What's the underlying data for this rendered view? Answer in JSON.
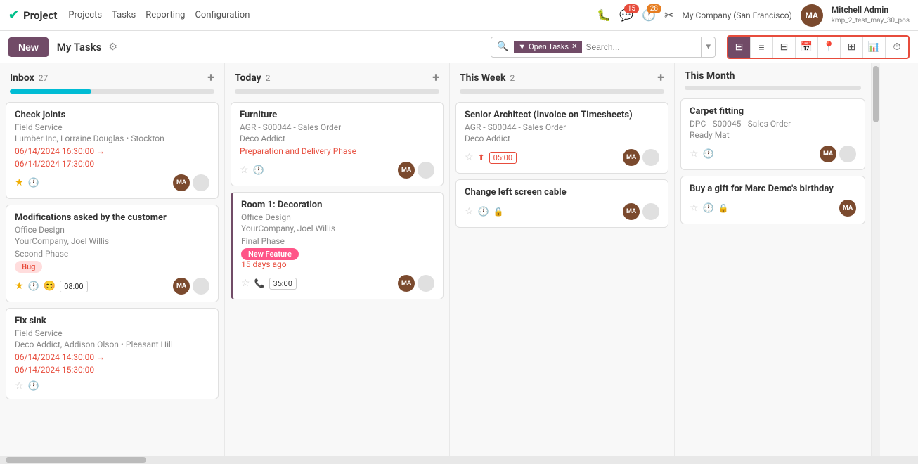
{
  "app": {
    "logo_check": "✔",
    "logo_name": "Project"
  },
  "topnav": {
    "links": [
      "Projects",
      "Tasks",
      "Reporting",
      "Configuration"
    ],
    "bug_icon": "🐛",
    "chat_count": "15",
    "clock_count": "28",
    "wrench_icon": "🔧",
    "company": "My Company (San Francisco)",
    "user_name": "Mitchell Admin",
    "user_db": "kmp_2_test_may_30_pos",
    "avatar_initials": "MA"
  },
  "toolbar": {
    "new_label": "New",
    "page_title": "My Tasks",
    "gear_icon": "⚙",
    "filter_label": "Open Tasks",
    "search_placeholder": "Search...",
    "view_icons": [
      "▦",
      "≡",
      "⊟",
      "▦",
      "📍",
      "⊞",
      "📊",
      "⏱"
    ]
  },
  "columns": [
    {
      "id": "inbox",
      "title": "Inbox",
      "count": "27",
      "progress": 40,
      "cards": [
        {
          "title": "Check joints",
          "subtitle": "Field Service",
          "sub2": "Lumber Inc, Lorraine Douglas • Stockton",
          "date1": "06/14/2024 16:30:00 →",
          "date2": "06/14/2024 17:30:00",
          "star": true,
          "clock": true,
          "avatar": true,
          "circle": true
        },
        {
          "title": "Modifications asked by the customer",
          "subtitle": "Office Design",
          "sub2": "YourCompany, Joel Willis",
          "sub3": "Second Phase",
          "badge": "Bug",
          "badge_type": "bug",
          "star": true,
          "clock": true,
          "smile": true,
          "time": "08:00",
          "avatar": true,
          "circle": true
        },
        {
          "title": "Fix sink",
          "subtitle": "Field Service",
          "sub2": "Deco Addict, Addison Olson • Pleasant Hill",
          "date1": "06/14/2024 14:30:00 →",
          "date2": "06/14/2024 15:30:00",
          "star": false,
          "clock": true,
          "avatar": false,
          "circle": false
        }
      ]
    },
    {
      "id": "today",
      "title": "Today",
      "count": "2",
      "progress": 0,
      "cards": [
        {
          "title": "Furniture",
          "subtitle": "AGR - S00044 - Sales Order",
          "sub2": "Deco Addict",
          "phase": "Preparation and Delivery Phase",
          "star": false,
          "clock": true,
          "avatar": true,
          "circle": true
        },
        {
          "title": "Room 1: Decoration",
          "subtitle": "Office Design",
          "sub2": "YourCompany, Joel Willis",
          "sub3": "Final Phase",
          "badge": "New Feature",
          "badge_type": "new_feature",
          "days_ago": "15 days ago",
          "star": false,
          "clock": false,
          "phone": true,
          "time": "35:00",
          "avatar": true,
          "circle": true,
          "highlighted": true
        }
      ]
    },
    {
      "id": "thisweek",
      "title": "This Week",
      "count": "2",
      "progress": 0,
      "cards": [
        {
          "title": "Senior Architect (Invoice on Timesheets)",
          "subtitle": "AGR - S00044 - Sales Order",
          "sub2": "Deco Addict",
          "star": false,
          "upload": true,
          "time_red": "05:00",
          "avatar": true,
          "circle": true
        },
        {
          "title": "Change left screen cable",
          "star": false,
          "clock": true,
          "lock": true,
          "avatar": true,
          "circle": true
        }
      ]
    },
    {
      "id": "thismonth",
      "title": "This Month",
      "count": "",
      "progress": 0,
      "cards": [
        {
          "title": "Carpet fitting",
          "subtitle": "DPC - S00045 - Sales Order",
          "sub2": "Ready Mat",
          "star": false,
          "clock": true,
          "avatar": true,
          "circle": true
        },
        {
          "title": "Buy a gift for Marc Demo's birthday",
          "star": false,
          "clock": true,
          "lock": true,
          "avatar": true,
          "circle": false
        }
      ]
    }
  ]
}
